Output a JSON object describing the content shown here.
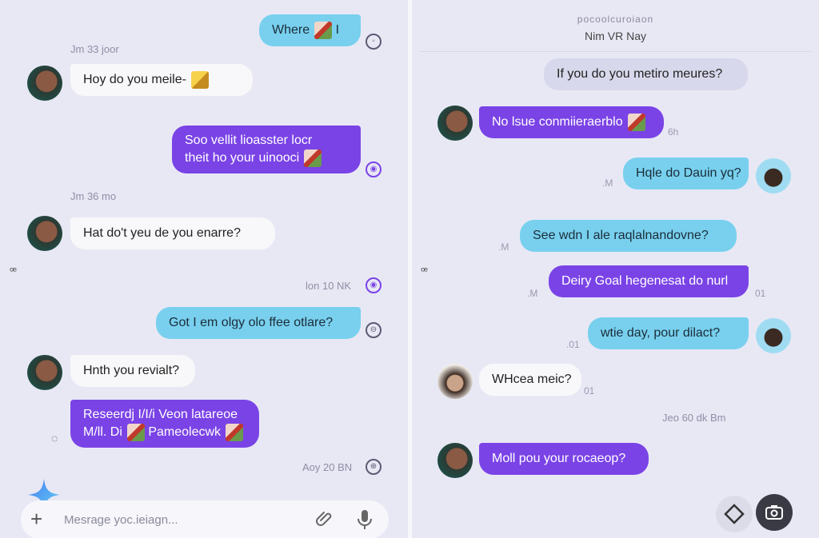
{
  "left": {
    "messages": [
      {
        "text": "Where",
        "side": "out"
      },
      {
        "text": "Hoy do you meile-"
      },
      {
        "text1": "Soo vellit lioasster locr",
        "text2": "theit ho your uinooci"
      },
      {
        "text": "Hat do't yeu de you enarre?"
      },
      {
        "text": "Got I em olgy olo ffee otlare?"
      },
      {
        "text": "Hnth you revialt?"
      },
      {
        "text1": "Reseerdj I/I/i Veon latareoe",
        "text2": "M/ll. Di",
        "text3": "Pameolecwk"
      }
    ],
    "timestamps": [
      "Jm 33 joor",
      "Jm 36 mo",
      "lon 10 NK",
      "Aoy 20 BN"
    ],
    "composer": {
      "placeholder": "Mesrage yoc.ieiagn..."
    }
  },
  "right": {
    "header": {
      "line1": "pocoolcuroiaon",
      "line2": "Nim VR Nay"
    },
    "messages": [
      {
        "text": "If you do you metiro meures?"
      },
      {
        "text": "No lsue conmiieraerblo"
      },
      {
        "text": "Hqle do Dauin yq?"
      },
      {
        "text": "See wdn I ale raqlalnandovne?"
      },
      {
        "text": "Deiry Goal hegenesat do nurl"
      },
      {
        "text": "wtie day, pour dilact?"
      },
      {
        "text": "WHcea meic?"
      },
      {
        "text": "Moll pou your rocaeop?"
      }
    ],
    "marks": [
      "6h",
      ".M",
      ".M",
      ".M",
      "01",
      ".01",
      "01"
    ],
    "timestamp": "Jeo 60 dk Bm"
  }
}
